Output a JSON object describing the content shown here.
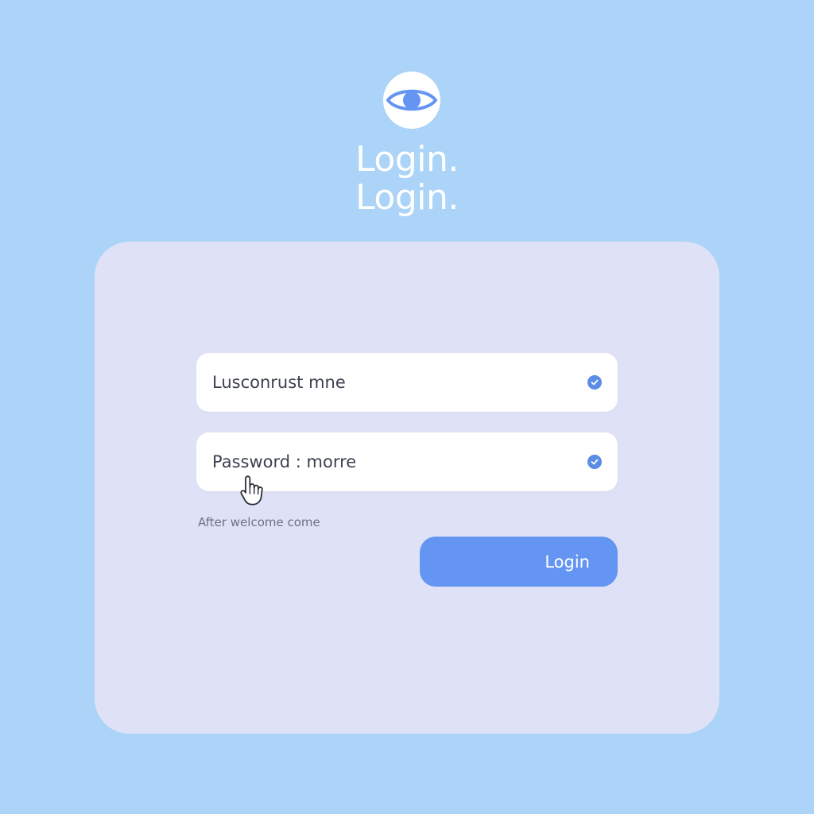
{
  "header": {
    "logo_icon": "eye-icon",
    "title_line_1": "Login.",
    "title_line_2": "Login."
  },
  "form": {
    "username": {
      "value": "Lusconrust mne",
      "status_icon": "check-circle-icon"
    },
    "password": {
      "value": "Password : morre",
      "status_icon": "check-circle-icon"
    },
    "helper_text": "After welcome come",
    "login_button_label": "Login"
  },
  "pointer": {
    "icon": "hand-pointer-icon"
  },
  "colors": {
    "background": "#acd4f8",
    "card": "#dfe2f6",
    "accent": "#6495f2",
    "check": "#5b8de6",
    "text": "#3c4150"
  }
}
